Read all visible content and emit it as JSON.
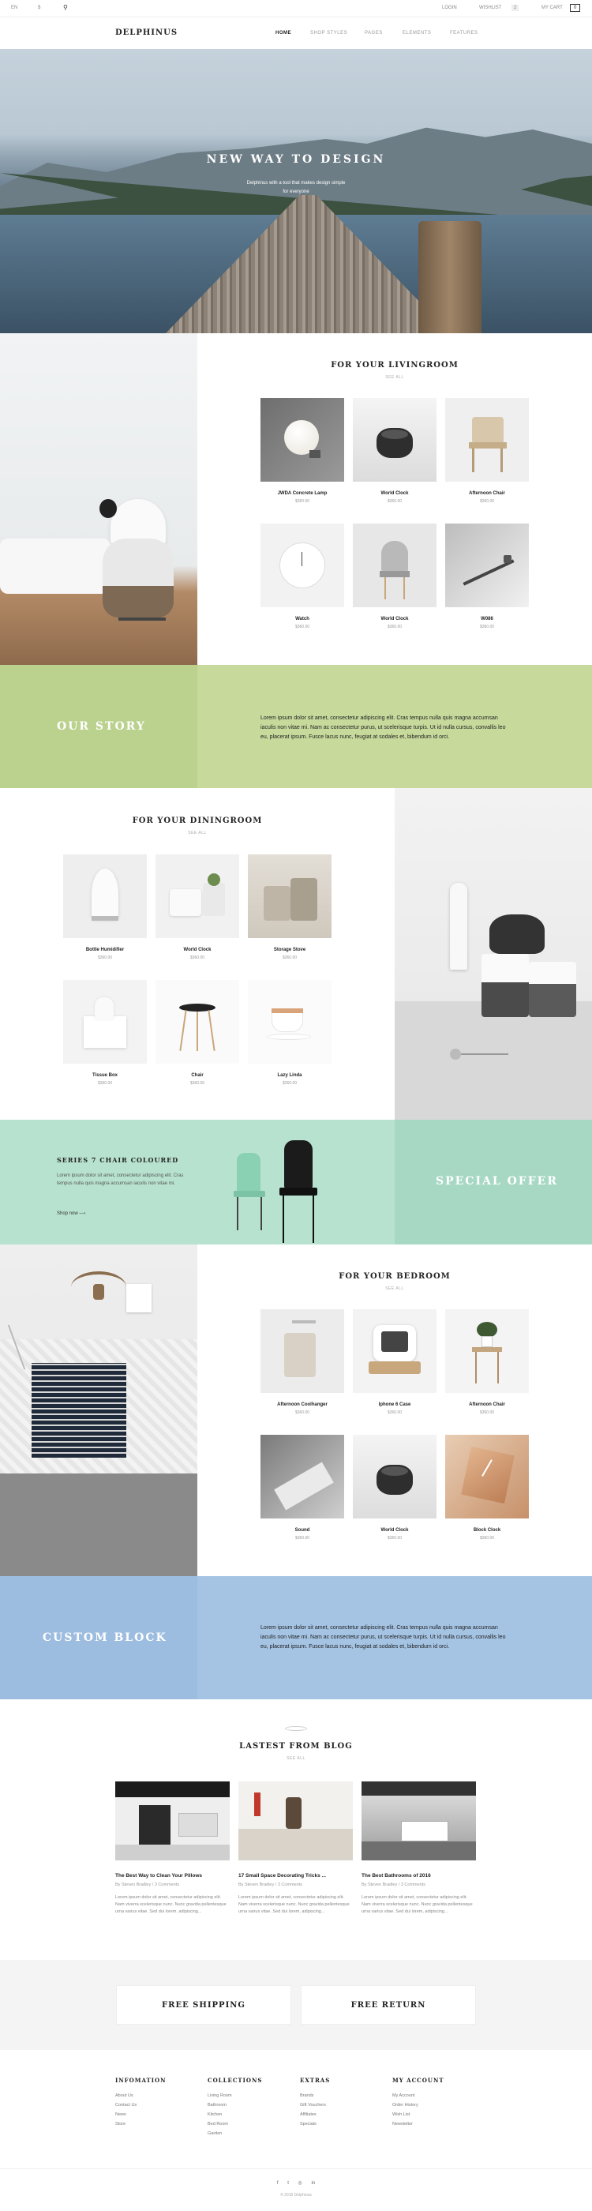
{
  "topbar": {
    "lang": "EN",
    "currency": "$",
    "login": "LOGIN",
    "wishlist": "WISHLIST",
    "wishlist_count": "2",
    "cart": "MY CART",
    "cart_count": "0"
  },
  "header": {
    "logo": "DELPHINUS",
    "nav": [
      "HOME",
      "SHOP STYLES",
      "PAGES",
      "ELEMENTS",
      "FEATURES"
    ]
  },
  "hero": {
    "title": "NEW WAY TO DESIGN",
    "subtitle_line1": "Delphinus with a tool that makes design simple",
    "subtitle_line2": "for everyone"
  },
  "living": {
    "title": "FOR YOUR LIVINGROOM",
    "see_all": "SEE ALL",
    "products": [
      {
        "name": "JWDA Concrete Lamp",
        "price": "$360.00"
      },
      {
        "name": "World Clock",
        "price": "$360.00"
      },
      {
        "name": "Afternoon Chair",
        "price": "$360.00"
      },
      {
        "name": "Watch",
        "price": "$360.00"
      },
      {
        "name": "World Clock",
        "price": "$360.00"
      },
      {
        "name": "W086",
        "price": "$360.00"
      }
    ]
  },
  "story": {
    "title": "OUR STORY",
    "text": "Lorem ipsum dolor sit amet, consectetur adipiscing elit. Cras tempus nulla quis magna accumsan iaculis non vitae mi. Nam ac consectetur purus, ut scelerisque turpis. Ut id nulla cursus, convallis leo eu, placerat ipsum. Fusce lacus nunc, feugiat at sodales et, bibendum id orci."
  },
  "dining": {
    "title": "FOR YOUR DININGROOM",
    "see_all": "SEE ALL",
    "products": [
      {
        "name": "Bottle Humidifier",
        "price": "$360.00"
      },
      {
        "name": "World Clock",
        "price": "$360.00"
      },
      {
        "name": "Storage Stove",
        "price": "$360.00"
      },
      {
        "name": "Tissue Box",
        "price": "$360.00"
      },
      {
        "name": "Chair",
        "price": "$360.00"
      },
      {
        "name": "Lazy Linda",
        "price": "$360.00"
      }
    ]
  },
  "offer": {
    "heading": "SERIES 7 CHAIR COLOURED",
    "text": "Lorem ipsum dolor sit amet, consectetur adipiscing elit. Cras tempus nulla quis magna accumsan iaculis non vitae mi.",
    "link": "Shop now",
    "badge": "SPECIAL OFFER"
  },
  "bedroom": {
    "title": "FOR YOUR BEDROOM",
    "see_all": "SEE ALL",
    "products": [
      {
        "name": "Afternoon Coolhanger",
        "price": "$360.00"
      },
      {
        "name": "Iphone 6 Case",
        "price": "$360.00"
      },
      {
        "name": "Afternoon Chair",
        "price": "$360.00"
      },
      {
        "name": "Sound",
        "price": "$360.00"
      },
      {
        "name": "World Clock",
        "price": "$360.00"
      },
      {
        "name": "Block Clock",
        "price": "$360.00"
      }
    ]
  },
  "custom": {
    "title": "CUSTOM BLOCK",
    "text": "Lorem ipsum dolor sit amet, consectetur adipiscing elit. Cras tempus nulla quis magna accumsan iaculis non vitae mi. Nam ac consectetur purus, ut scelerisque turpis. Ut id nulla cursus, convallis leo eu, placerat ipsum. Fusce lacus nunc, feugiat at sodales et, bibendum id orci."
  },
  "blog": {
    "title": "LASTEST FROM BLOG",
    "see_all": "SEE ALL",
    "posts": [
      {
        "title": "The Best Way to Clean Your Pillows",
        "by": "By Steven Bradley / 3 Comments",
        "excerpt": "Lorem ipsum dolor sit amet, consectetur adipiscing elit. Nam viverra scelerisque nunc. Nunc gravida pellentesque urna varius vitae. Sed dui lorem, adipiscing..."
      },
      {
        "title": "17 Small Space Decorating Tricks ...",
        "by": "By Steven Bradley / 3 Comments",
        "excerpt": "Lorem ipsum dolor sit amet, consectetur adipiscing elit. Nam viverra scelerisque nunc. Nunc gravida pellentesque urna varius vitae. Sed dui lorem, adipiscing..."
      },
      {
        "title": "The Best Bathrooms of 2016",
        "by": "By Steven Bradley / 3 Comments",
        "excerpt": "Lorem ipsum dolor sit amet, consectetur adipiscing elit. Nam viverra scelerisque nunc. Nunc gravida pellentesque urna varius vitae. Sed dui lorem, adipiscing..."
      }
    ]
  },
  "services": {
    "shipping": "FREE SHIPPING",
    "return": "FREE RETURN"
  },
  "footer": {
    "cols": [
      {
        "title": "INFOMATION",
        "links": [
          "About Us",
          "Contact Us",
          "News",
          "Store"
        ]
      },
      {
        "title": "COLLECTIONS",
        "links": [
          "Living Room",
          "Bathroom",
          "Kitchen",
          "Bed Room",
          "Garden"
        ]
      },
      {
        "title": "EXTRAS",
        "links": [
          "Brands",
          "Gift Vouchers",
          "Affiliates",
          "Specials"
        ]
      },
      {
        "title": "MY ACCOUNT",
        "links": [
          "My Account",
          "Order History",
          "Wish List",
          "Newsletter"
        ]
      }
    ],
    "social": [
      "f",
      "t",
      "◎",
      "in"
    ],
    "copyright": "© 2016 Delphinus"
  },
  "colors": {
    "green": "#c7da9c",
    "mint": "#b8e2d0",
    "blue": "#a5c4e4",
    "grey": "#f4f4f4"
  }
}
